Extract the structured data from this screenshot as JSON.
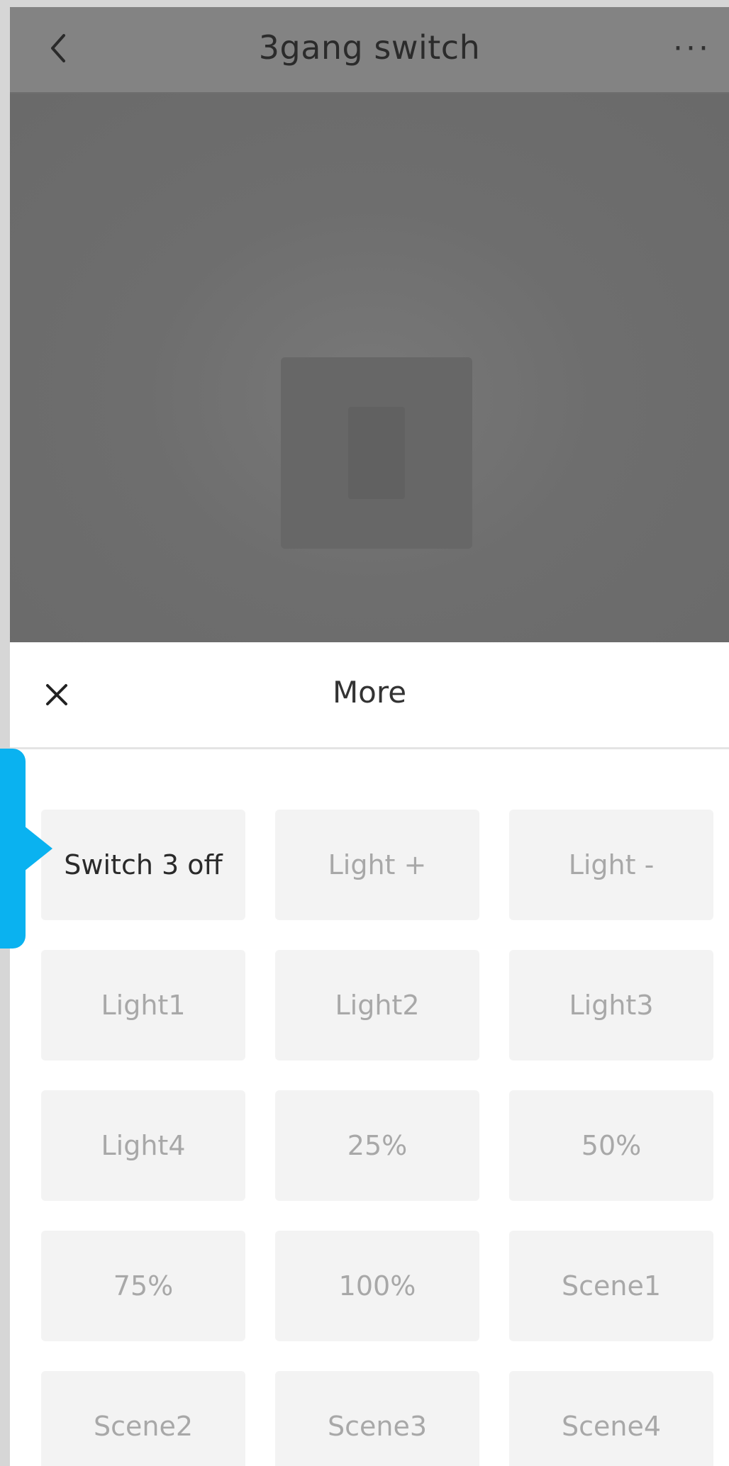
{
  "header": {
    "title": "3gang switch",
    "back_icon": "chevron-left-icon",
    "more_icon": "more-dots-icon",
    "more_glyph": "···"
  },
  "device": {
    "image": "device-preview"
  },
  "sheet": {
    "title": "More",
    "close_icon": "close-icon",
    "close_glyph": "✕",
    "options": [
      {
        "label": "Switch 3 off",
        "active": true
      },
      {
        "label": "Light +",
        "active": false
      },
      {
        "label": "Light -",
        "active": false
      },
      {
        "label": "Light1",
        "active": false
      },
      {
        "label": "Light2",
        "active": false
      },
      {
        "label": "Light3",
        "active": false
      },
      {
        "label": "Light4",
        "active": false
      },
      {
        "label": "25%",
        "active": false
      },
      {
        "label": "50%",
        "active": false
      },
      {
        "label": "75%",
        "active": false
      },
      {
        "label": "100%",
        "active": false
      },
      {
        "label": "Scene1",
        "active": false
      },
      {
        "label": "Scene2",
        "active": false
      },
      {
        "label": "Scene3",
        "active": false
      },
      {
        "label": "Scene4",
        "active": false
      }
    ]
  },
  "colors": {
    "callout": "#0ab2f0",
    "tile_bg": "#f3f3f3",
    "tile_text_active": "#2a2a2a",
    "tile_text_inactive": "#a8a8a8"
  }
}
